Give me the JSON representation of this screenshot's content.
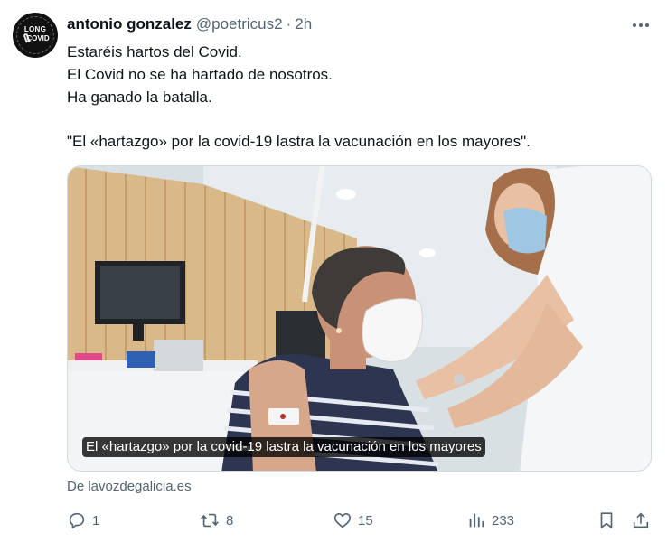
{
  "author": {
    "name": "antonio gonzalez",
    "handle": "@poetricus2",
    "separator": "·",
    "time": "2h",
    "avatar_text_top": "LONG",
    "avatar_text_bottom": "COVID"
  },
  "tweet_lines": [
    "Estaréis hartos del Covid.",
    "El Covid no se ha hartado de nosotros.",
    "Ha ganado la batalla.",
    "",
    "\"El «hartazgo» por la covid-19 lastra la vacunación en los mayores\"."
  ],
  "card": {
    "caption": "El «hartazgo» por la covid-19 lastra la vacunación en los mayores",
    "source": "De lavozdegalicia.es"
  },
  "actions": {
    "replies": "1",
    "retweets": "8",
    "likes": "15",
    "views": "233"
  },
  "icons": [
    "more-icon",
    "reply-icon",
    "retweet-icon",
    "like-icon",
    "views-icon",
    "bookmark-icon",
    "share-icon"
  ],
  "colors": {
    "text_primary": "#0f1419",
    "text_secondary": "#536471",
    "border": "#cfd9de"
  }
}
